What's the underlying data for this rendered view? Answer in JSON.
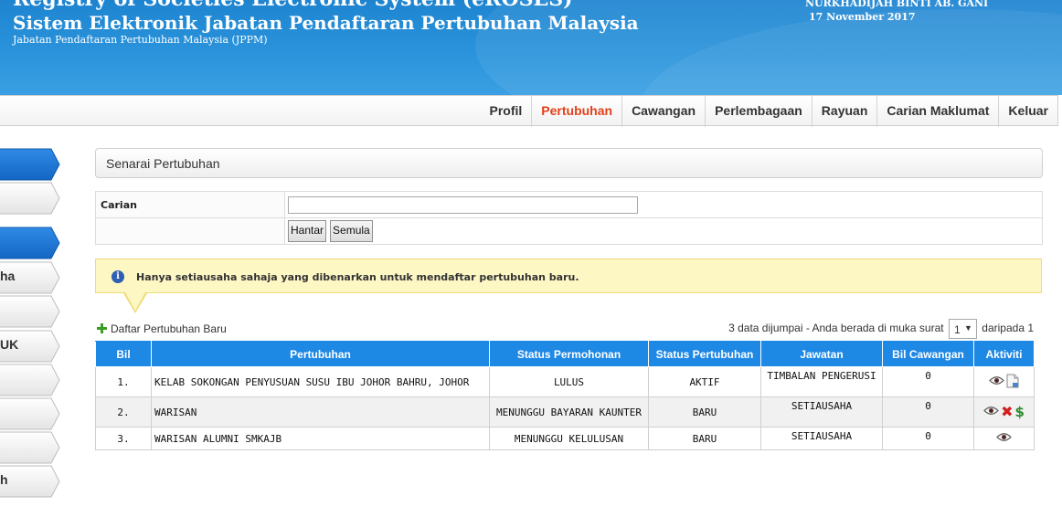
{
  "header": {
    "title_line1": "Registry of Societies Electronic System (eROSES)",
    "title_line2": "Sistem Elektronik Jabatan Pendaftaran Pertubuhan Malaysia",
    "subtitle": "Jabatan Pendaftaran Pertubuhan Malaysia (JPPM)",
    "user_name": "NURKHADIJAH BINTI AB. GANI",
    "date": "17 November 2017"
  },
  "nav": {
    "items": [
      {
        "label": "Profil",
        "active": false
      },
      {
        "label": "Pertubuhan",
        "active": true
      },
      {
        "label": "Cawangan",
        "active": false
      },
      {
        "label": "Perlembagaan",
        "active": false
      },
      {
        "label": "Rayuan",
        "active": false
      },
      {
        "label": "Carian Maklumat",
        "active": false
      },
      {
        "label": "Keluar",
        "active": false
      }
    ],
    "active_color": "#e2401a"
  },
  "sidebar": {
    "items": [
      {
        "label": "",
        "style": "blue"
      },
      {
        "label": "",
        "style": "grey"
      },
      {
        "label": "",
        "style": "blue"
      },
      {
        "label": "ha",
        "style": "grey"
      },
      {
        "label": "",
        "style": "grey"
      },
      {
        "label": "UK",
        "style": "grey"
      },
      {
        "label": "",
        "style": "grey"
      },
      {
        "label": "",
        "style": "grey"
      },
      {
        "label": "",
        "style": "grey"
      },
      {
        "label": "h",
        "style": "grey"
      }
    ]
  },
  "panel": {
    "title": "Senarai Pertubuhan"
  },
  "search": {
    "label": "Carian",
    "value": "",
    "submit_label": "Hantar",
    "reset_label": "Semula"
  },
  "notice": {
    "message": "Hanya setiausaha sahaja yang dibenarkan untuk mendaftar pertubuhan baru.",
    "icon": "info-icon"
  },
  "add_link": {
    "label": "Daftar Pertubuhan Baru",
    "icon": "plus-icon"
  },
  "pager": {
    "text_before": "3 data dijumpai - Anda berada di muka surat",
    "current_page": "1",
    "text_after": "daripada 1"
  },
  "table": {
    "headers": [
      "Bil",
      "Pertubuhan",
      "Status Permohonan",
      "Status Pertubuhan",
      "Jawatan",
      "Bil Cawangan",
      "Aktiviti"
    ],
    "header_color": "#1e88e5",
    "rows": [
      {
        "bil": "1.",
        "pertubuhan": "KELAB SOKONGAN PENYUSUAN SUSU IBU JOHOR BAHRU, JOHOR",
        "status_permohonan": "LULUS",
        "status_pertubuhan": "AKTIF",
        "jawatan": "TIMBALAN PENGERUSI",
        "bil_cawangan": "0",
        "actions": [
          "view-eye-icon",
          "document-icon"
        ]
      },
      {
        "bil": "2.",
        "pertubuhan": "WARISAN",
        "status_permohonan": "MENUNGGU BAYARAN KAUNTER",
        "status_pertubuhan": "BARU",
        "jawatan": "SETIAUSAHA",
        "bil_cawangan": "0",
        "actions": [
          "view-eye-icon",
          "delete-x-icon",
          "payment-dollar-icon"
        ]
      },
      {
        "bil": "3.",
        "pertubuhan": "WARISAN ALUMNI SMKAJB",
        "status_permohonan": "MENUNGGU KELULUSAN",
        "status_pertubuhan": "BARU",
        "jawatan": "SETIAUSAHA",
        "bil_cawangan": "0",
        "actions": [
          "view-eye-icon"
        ]
      }
    ]
  }
}
